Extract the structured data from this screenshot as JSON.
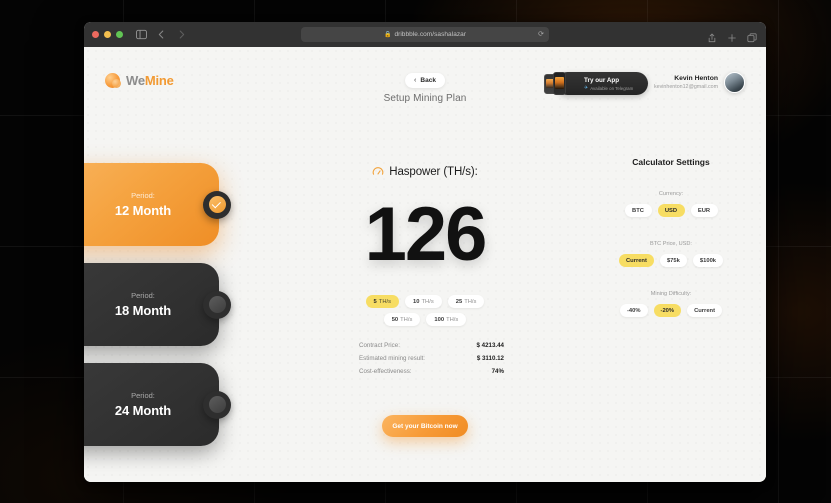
{
  "browser": {
    "url": "dribbble.com/sashalazar",
    "lock_icon": "lock-icon",
    "reload_icon": "reload-icon",
    "back_icon": "chevron-left-icon",
    "forward_icon": "chevron-right-icon",
    "sidebar_icon": "sidebar-icon",
    "reader_icon": "reader-icon",
    "share_icon": "share-icon",
    "newtab_icon": "plus-icon",
    "tabs_icon": "tabs-icon"
  },
  "header": {
    "logo_first": "We",
    "logo_second": "Mine",
    "back_label": "Back",
    "back_chevron": "‹",
    "page_title": "Setup Mining Plan",
    "try_app": {
      "title": "Try our App",
      "subtitle": "Available on Telegram",
      "badge_icon": "telegram-icon"
    },
    "user": {
      "name": "Kevin Henton",
      "email": "kevinhenton12@gmail.com"
    }
  },
  "periods": [
    {
      "sub": "Period:",
      "main": "12 Month",
      "selected": true
    },
    {
      "sub": "Period:",
      "main": "18 Month",
      "selected": false
    },
    {
      "sub": "Period:",
      "main": "24 Month",
      "selected": false
    }
  ],
  "haspower": {
    "label": "Haspower (TH/s):",
    "value": "126",
    "icon": "gauge-icon",
    "options_row1": [
      {
        "num": "5",
        "unit": "TH/s",
        "selected": true
      },
      {
        "num": "10",
        "unit": "TH/s",
        "selected": false
      },
      {
        "num": "25",
        "unit": "TH/s",
        "selected": false
      }
    ],
    "options_row2": [
      {
        "num": "50",
        "unit": "TH/s",
        "selected": false
      },
      {
        "num": "100",
        "unit": "TH/s",
        "selected": false
      }
    ]
  },
  "facts": [
    {
      "key": "Contract Price:",
      "value": "$ 4213.44"
    },
    {
      "key": "Estimated mining result:",
      "value": "$ 3110.12"
    },
    {
      "key": "Cost-effectiveness:",
      "value": "74%"
    }
  ],
  "cta_label": "Get your Bitcoin now",
  "calculator": {
    "title": "Calculator Settings",
    "groups": [
      {
        "label": "Currency:",
        "options": [
          {
            "label": "BTC",
            "selected": false
          },
          {
            "label": "USD",
            "selected": true
          },
          {
            "label": "EUR",
            "selected": false
          }
        ]
      },
      {
        "label": "BTC Price, USD:",
        "options": [
          {
            "label": "Current",
            "selected": true
          },
          {
            "label": "$75k",
            "selected": false
          },
          {
            "label": "$100k",
            "selected": false
          }
        ]
      },
      {
        "label": "Mining Difficulty:",
        "options": [
          {
            "label": "-40%",
            "selected": false
          },
          {
            "label": "-20%",
            "selected": true
          },
          {
            "label": "Current",
            "selected": false
          }
        ]
      }
    ]
  },
  "colors": {
    "accent_orange": "#f29a33",
    "select_yellow": "#f7dd63",
    "dark_card": "#2f2f2f",
    "page_bg": "#f5f5f3"
  }
}
